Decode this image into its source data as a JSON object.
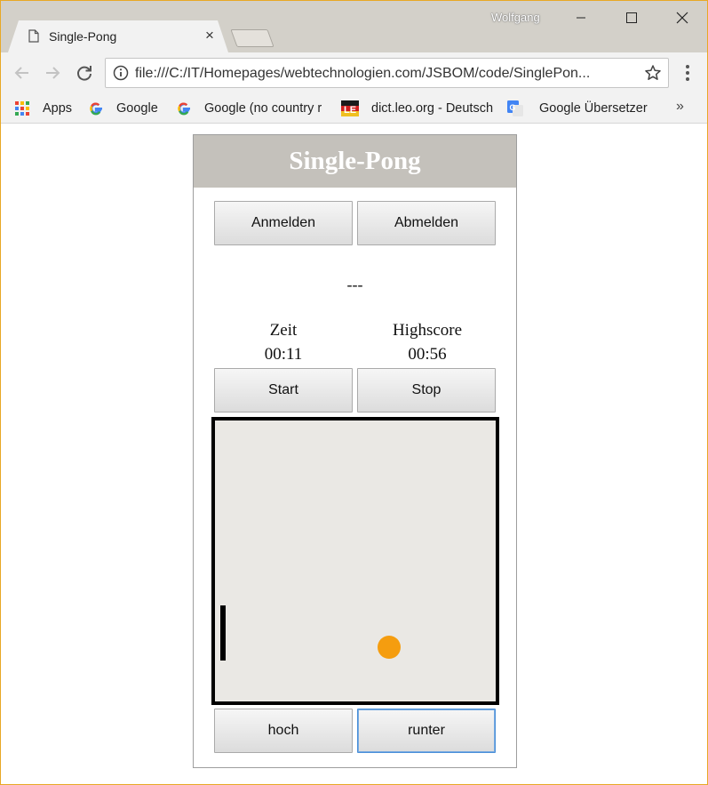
{
  "browser": {
    "tab_title": "Single-Pong",
    "tab_close": "×",
    "profile_name": "Wolfgang",
    "url": "file:///C:/IT/Homepages/webtechnologien.com/JSBOM/code/SinglePon...",
    "bookmarks": [
      {
        "label": "Apps",
        "icon": "apps-grid-icon"
      },
      {
        "label": "Google",
        "icon": "google-icon"
      },
      {
        "label": "Google (no country r",
        "icon": "google-icon"
      },
      {
        "label": "dict.leo.org - Deutsch",
        "icon": "leo-icon"
      },
      {
        "label": "Google Übersetzer",
        "icon": "google-translate-icon"
      }
    ],
    "more": "»"
  },
  "app": {
    "title": "Single-Pong",
    "login_label": "Anmelden",
    "logout_label": "Abmelden",
    "status": "---",
    "time_label": "Zeit",
    "time_value": "00:11",
    "highscore_label": "Highscore",
    "highscore_value": "00:56",
    "start_label": "Start",
    "stop_label": "Stop",
    "up_label": "hoch",
    "down_label": "runter",
    "ball_color": "#f59d0f",
    "court_color": "#eae8e4"
  }
}
